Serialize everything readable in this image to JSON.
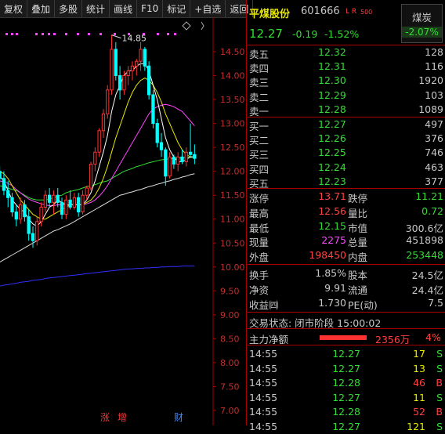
{
  "toolbar": {
    "items": [
      "复权",
      "叠加",
      "多股",
      "统计",
      "画线",
      "F10",
      "标记",
      "+自选",
      "返回"
    ]
  },
  "chart": {
    "price_ticks": [
      "14.50",
      "14.00",
      "13.50",
      "13.00",
      "12.50",
      "12.00",
      "11.50",
      "11.00",
      "10.50",
      "10.00",
      "9.50",
      "9.00",
      "8.50",
      "8.00",
      "7.50",
      "7.00"
    ],
    "high_label": "14.85",
    "event_markers": [
      "涨",
      "增",
      "财"
    ],
    "colors": {
      "up": "#ff3232",
      "down": "#00ffff",
      "ma5": "#ffffff",
      "ma10": "#e8e800",
      "ma20": "#ff44ff",
      "ma60": "#33dd33",
      "ma120": "#dddddd",
      "ma250": "#3030ff"
    },
    "chart_data": {
      "type": "candlestick",
      "ylim": [
        7.0,
        14.75
      ],
      "candles": [
        {
          "o": 12.0,
          "h": 12.1,
          "l": 11.75,
          "c": 11.85
        },
        {
          "o": 11.85,
          "h": 12.0,
          "l": 11.5,
          "c": 11.6
        },
        {
          "o": 11.6,
          "h": 11.8,
          "l": 11.25,
          "c": 11.45
        },
        {
          "o": 11.45,
          "h": 11.55,
          "l": 11.05,
          "c": 11.15
        },
        {
          "o": 11.15,
          "h": 11.3,
          "l": 10.85,
          "c": 11.0
        },
        {
          "o": 11.0,
          "h": 11.45,
          "l": 10.9,
          "c": 11.3
        },
        {
          "o": 11.3,
          "h": 11.4,
          "l": 10.95,
          "c": 11.05
        },
        {
          "o": 11.05,
          "h": 11.2,
          "l": 10.55,
          "c": 10.7
        },
        {
          "o": 10.7,
          "h": 10.85,
          "l": 10.4,
          "c": 10.55
        },
        {
          "o": 10.55,
          "h": 11.05,
          "l": 10.45,
          "c": 10.95
        },
        {
          "o": 10.95,
          "h": 11.35,
          "l": 10.85,
          "c": 11.25
        },
        {
          "o": 11.25,
          "h": 11.6,
          "l": 11.15,
          "c": 11.5
        },
        {
          "o": 11.5,
          "h": 11.65,
          "l": 11.25,
          "c": 11.35
        },
        {
          "o": 11.35,
          "h": 11.6,
          "l": 11.1,
          "c": 11.5
        },
        {
          "o": 11.5,
          "h": 11.65,
          "l": 11.25,
          "c": 11.35
        },
        {
          "o": 11.35,
          "h": 11.45,
          "l": 11.0,
          "c": 11.1
        },
        {
          "o": 11.1,
          "h": 11.5,
          "l": 11.0,
          "c": 11.4
        },
        {
          "o": 11.4,
          "h": 11.6,
          "l": 11.2,
          "c": 11.25
        },
        {
          "o": 11.25,
          "h": 11.55,
          "l": 11.2,
          "c": 11.45
        },
        {
          "o": 11.45,
          "h": 11.55,
          "l": 11.05,
          "c": 11.15
        },
        {
          "o": 11.15,
          "h": 11.6,
          "l": 11.1,
          "c": 11.5
        },
        {
          "o": 11.5,
          "h": 11.7,
          "l": 11.4,
          "c": 11.65
        },
        {
          "o": 11.65,
          "h": 12.2,
          "l": 11.6,
          "c": 12.15
        },
        {
          "o": 12.15,
          "h": 12.5,
          "l": 12.0,
          "c": 12.4
        },
        {
          "o": 12.4,
          "h": 12.9,
          "l": 12.3,
          "c": 12.85
        },
        {
          "o": 12.85,
          "h": 13.3,
          "l": 12.7,
          "c": 13.2
        },
        {
          "o": 13.2,
          "h": 13.8,
          "l": 13.1,
          "c": 13.7
        },
        {
          "o": 13.7,
          "h": 14.85,
          "l": 13.6,
          "c": 14.55
        },
        {
          "o": 14.55,
          "h": 14.7,
          "l": 13.9,
          "c": 14.0
        },
        {
          "o": 14.0,
          "h": 14.2,
          "l": 13.5,
          "c": 13.7
        },
        {
          "o": 13.7,
          "h": 14.1,
          "l": 13.6,
          "c": 14.0
        },
        {
          "o": 14.0,
          "h": 14.2,
          "l": 13.8,
          "c": 14.1
        },
        {
          "o": 14.1,
          "h": 14.3,
          "l": 13.9,
          "c": 14.2
        },
        {
          "o": 14.2,
          "h": 14.35,
          "l": 14.0,
          "c": 14.3
        },
        {
          "o": 14.3,
          "h": 14.7,
          "l": 14.1,
          "c": 14.55
        },
        {
          "o": 14.55,
          "h": 14.6,
          "l": 14.1,
          "c": 14.2
        },
        {
          "o": 14.2,
          "h": 14.3,
          "l": 13.5,
          "c": 13.6
        },
        {
          "o": 13.6,
          "h": 13.7,
          "l": 12.9,
          "c": 13.0
        },
        {
          "o": 13.0,
          "h": 13.1,
          "l": 12.5,
          "c": 12.6
        },
        {
          "o": 12.6,
          "h": 12.8,
          "l": 12.3,
          "c": 12.45
        },
        {
          "o": 12.45,
          "h": 12.5,
          "l": 11.7,
          "c": 11.9
        },
        {
          "o": 11.9,
          "h": 12.4,
          "l": 11.85,
          "c": 12.3
        },
        {
          "o": 12.3,
          "h": 12.35,
          "l": 12.05,
          "c": 12.15
        },
        {
          "o": 12.15,
          "h": 12.4,
          "l": 12.0,
          "c": 12.3
        },
        {
          "o": 12.3,
          "h": 12.45,
          "l": 12.15,
          "c": 12.2
        },
        {
          "o": 12.2,
          "h": 12.5,
          "l": 12.1,
          "c": 12.4
        },
        {
          "o": 12.4,
          "h": 13.0,
          "l": 12.3,
          "c": 12.35
        },
        {
          "o": 12.35,
          "h": 12.56,
          "l": 12.15,
          "c": 12.27
        }
      ],
      "ma5": [
        11.9,
        11.8,
        11.6,
        11.4,
        11.3,
        11.2,
        11.15,
        11.0,
        10.9,
        10.85,
        10.95,
        11.1,
        11.25,
        11.3,
        11.4,
        11.35,
        11.3,
        11.3,
        11.3,
        11.3,
        11.3,
        11.4,
        11.55,
        11.8,
        12.1,
        12.4,
        12.75,
        13.25,
        13.6,
        13.8,
        14.0,
        14.1,
        14.1,
        14.2,
        14.25,
        14.25,
        14.1,
        13.8,
        13.5,
        13.1,
        12.7,
        12.45,
        12.3,
        12.2,
        12.2,
        12.25,
        12.3,
        12.3
      ],
      "ma10": [
        12.0,
        11.95,
        11.85,
        11.7,
        11.55,
        11.4,
        11.3,
        11.2,
        11.1,
        11.05,
        11.0,
        11.0,
        11.05,
        11.1,
        11.15,
        11.2,
        11.25,
        11.3,
        11.3,
        11.3,
        11.3,
        11.35,
        11.4,
        11.5,
        11.65,
        11.85,
        12.1,
        12.4,
        12.7,
        12.95,
        13.2,
        13.45,
        13.65,
        13.8,
        13.9,
        13.95,
        13.9,
        13.8,
        13.65,
        13.45,
        13.2,
        13.0,
        12.8,
        12.6,
        12.45,
        12.35,
        12.3,
        12.3
      ],
      "ma20": [
        11.8,
        11.78,
        11.75,
        11.7,
        11.62,
        11.55,
        11.48,
        11.42,
        11.38,
        11.35,
        11.32,
        11.3,
        11.28,
        11.28,
        11.3,
        11.3,
        11.3,
        11.3,
        11.3,
        11.3,
        11.3,
        11.32,
        11.35,
        11.4,
        11.48,
        11.58,
        11.7,
        11.85,
        12.0,
        12.15,
        12.3,
        12.45,
        12.6,
        12.75,
        12.9,
        13.05,
        13.2,
        13.3,
        13.35,
        13.38,
        13.4,
        13.38,
        13.35,
        13.3,
        13.25,
        13.15,
        13.05,
        12.95
      ],
      "ma60": [
        11.7,
        11.68,
        11.65,
        11.62,
        11.6,
        11.55,
        11.5,
        11.45,
        11.42,
        11.4,
        11.4,
        11.4,
        11.42,
        11.45,
        11.48,
        11.5,
        11.55,
        11.58,
        11.6,
        11.62,
        11.65,
        11.68,
        11.7,
        11.72,
        11.75,
        11.78,
        11.8,
        11.85,
        11.9,
        11.95,
        12.0,
        12.03,
        12.06,
        12.1,
        12.12,
        12.15,
        12.18,
        12.2,
        12.22,
        12.24,
        12.25,
        12.26,
        12.27,
        12.28,
        12.28,
        12.29,
        12.29,
        12.3
      ],
      "ma120": [
        10.1,
        10.15,
        10.2,
        10.25,
        10.3,
        10.35,
        10.4,
        10.45,
        10.5,
        10.55,
        10.6,
        10.65,
        10.7,
        10.75,
        10.78,
        10.82,
        10.86,
        10.9,
        10.95,
        11.0,
        11.05,
        11.1,
        11.15,
        11.2,
        11.25,
        11.3,
        11.35,
        11.4,
        11.45,
        11.5,
        11.52,
        11.55,
        11.57,
        11.6,
        11.62,
        11.65,
        11.68,
        11.7,
        11.73,
        11.75,
        11.78,
        11.8,
        11.83,
        11.85,
        11.88,
        11.9,
        11.93,
        11.95
      ],
      "ma250": [
        9.6,
        9.62,
        9.63,
        9.65,
        9.66,
        9.68,
        9.69,
        9.7,
        9.72,
        9.73,
        9.74,
        9.76,
        9.77,
        9.78,
        9.79,
        9.8,
        9.81,
        9.82,
        9.83,
        9.84,
        9.85,
        9.86,
        9.87,
        9.88,
        9.89,
        9.9,
        9.91,
        9.92,
        9.93,
        9.94,
        9.95,
        9.96,
        9.96,
        9.97,
        9.97,
        9.98,
        9.98,
        9.99,
        9.99,
        10.0,
        10.0,
        10.01,
        10.01,
        10.01,
        10.02,
        10.02,
        10.02,
        10.02
      ]
    }
  },
  "quote": {
    "name": "平煤股份",
    "code": "601666",
    "flags": "L R",
    "flag_sub": "500",
    "price": "12.27",
    "change": "-0.19",
    "change_pct": "-1.52%",
    "sector": "煤炭",
    "sector_change": "-2.07%"
  },
  "asks": [
    {
      "label": "卖五",
      "price": "12.32",
      "vol": "128"
    },
    {
      "label": "卖四",
      "price": "12.31",
      "vol": "116"
    },
    {
      "label": "卖三",
      "price": "12.30",
      "vol": "1920"
    },
    {
      "label": "卖二",
      "price": "12.29",
      "vol": "103"
    },
    {
      "label": "卖一",
      "price": "12.28",
      "vol": "1089"
    }
  ],
  "bids": [
    {
      "label": "买一",
      "price": "12.27",
      "vol": "497"
    },
    {
      "label": "买二",
      "price": "12.26",
      "vol": "376"
    },
    {
      "label": "买三",
      "price": "12.25",
      "vol": "746"
    },
    {
      "label": "买四",
      "price": "12.24",
      "vol": "463"
    },
    {
      "label": "买五",
      "price": "12.23",
      "vol": "377"
    }
  ],
  "stats1": [
    {
      "l1": "涨停",
      "v1": "13.71",
      "c1": "red",
      "l2": "跌停",
      "v2": "11.21",
      "c2": "green"
    },
    {
      "l1": "最高",
      "v1": "12.56",
      "c1": "red",
      "l2": "量比",
      "v2": "0.72",
      "c2": "green"
    },
    {
      "l1": "最低",
      "v1": "12.15",
      "c1": "green",
      "l2": "市值",
      "v2": "300.6亿",
      "c2": "gray"
    },
    {
      "l1": "现量",
      "v1": "2275",
      "c1": "mag",
      "l2": "总量",
      "v2": "451898",
      "c2": "gray"
    },
    {
      "l1": "外盘",
      "v1": "198450",
      "c1": "red",
      "l2": "内盘",
      "v2": "253448",
      "c2": "green"
    }
  ],
  "stats2": [
    {
      "l1": "换手",
      "v1": "1.85%",
      "l2": "股本",
      "v2": "24.5亿"
    },
    {
      "l1": "净资",
      "v1": "9.91",
      "l2": "流通",
      "v2": "24.4亿"
    },
    {
      "l1": "收益㈣",
      "v1": "1.730",
      "l2": "PE(动)",
      "v2": "7.5"
    }
  ],
  "trade_status": "交易状态: 闭市阶段 15:00:02",
  "main_flow": {
    "label": "主力净额",
    "value": "2356万",
    "pct": "4%",
    "bar_fraction": 0.25
  },
  "ticks": [
    {
      "time": "14:55",
      "price": "12.27",
      "vol": "17",
      "side": "S"
    },
    {
      "time": "14:55",
      "price": "12.27",
      "vol": "13",
      "side": "S"
    },
    {
      "time": "14:55",
      "price": "12.28",
      "vol": "46",
      "side": "B"
    },
    {
      "time": "14:55",
      "price": "12.27",
      "vol": "11",
      "side": "S"
    },
    {
      "time": "14:55",
      "price": "12.28",
      "vol": "52",
      "B": "",
      "side": "B"
    },
    {
      "time": "14:55",
      "price": "12.27",
      "vol": "121",
      "side": "S"
    }
  ]
}
